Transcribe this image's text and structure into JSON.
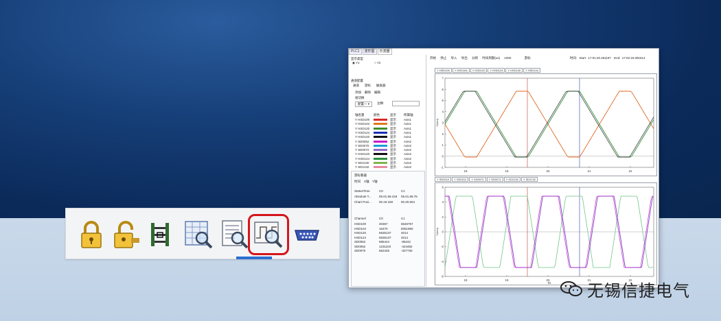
{
  "window": {
    "tabs": [
      "PLC1",
      "波形图",
      "示波器"
    ],
    "display_type_label": "显示类型",
    "radio_y1": "Y1",
    "radio_y2": "Y2",
    "channel_config_label": "通道配置",
    "sub_tabs": [
      "通道",
      "游标",
      "触发器"
    ],
    "actions": [
      "添加",
      "删除",
      "编辑"
    ],
    "group_label": "组切换",
    "group_select": "配置一",
    "note_label": "注释:",
    "table_headers": [
      "轴名量",
      "颜色",
      "显示",
      "所属轴"
    ],
    "channels": [
      {
        "name": "Y HSD100",
        "color": "#d62828",
        "show": "显示",
        "axis": "Axis1"
      },
      {
        "name": "Y HSD104",
        "color": "#e07a1f",
        "show": "显示",
        "axis": "Axis1"
      },
      {
        "name": "Y HSD120",
        "color": "#3c8f2f",
        "show": "显示",
        "axis": "Axis1"
      },
      {
        "name": "Y HSD124",
        "color": "#1b2fb3",
        "show": "显示",
        "axis": "Axis1"
      },
      {
        "name": "Y HSD140",
        "color": "#111111",
        "show": "显示",
        "axis": "Axis1"
      },
      {
        "name": "Y SD0052",
        "color": "#c61bc9",
        "show": "显示",
        "axis": "Axis2"
      },
      {
        "name": "Y SD0070",
        "color": "#1e9bd6",
        "show": "显示",
        "axis": "Axis2"
      },
      {
        "name": "Y SD0072",
        "color": "#8d6ac9",
        "show": "显示",
        "axis": "Axis2"
      },
      {
        "name": "Y HSD140",
        "color": "#111111",
        "show": "显示",
        "axis": "Axis2"
      },
      {
        "name": "Y HSD144",
        "color": "#2a8f3a",
        "show": "显示",
        "axis": "Axis2"
      },
      {
        "name": "Y SD2130",
        "color": "#7fb54a",
        "show": "显示",
        "axis": "Axis2"
      },
      {
        "name": "Y SD2132",
        "color": "#e98aa0",
        "show": "显示",
        "axis": "Axis2"
      }
    ],
    "cursor_panel_title": "游标看器",
    "cursor_tabs": [
      "时间",
      "X轴",
      "Y轴"
    ],
    "status_rows": [
      {
        "k": "StatusTime",
        "c0": "C0",
        "c1": "C1"
      },
      {
        "k": "Absolute T...",
        "c0": "05.01.59.419",
        "c1": "05.01.59.76"
      },
      {
        "k": "Chart Posi...",
        "c0": "00.19.158",
        "c1": "00.20.504"
      }
    ],
    "channel_values_header": {
      "k": "Channel",
      "c0": "C0",
      "c1": "C1"
    },
    "channel_values": [
      {
        "k": "HSD100",
        "c0": "40367",
        "c1": "6546757"
      },
      {
        "k": "HSD104",
        "c0": "16470",
        "c1": "6051960"
      },
      {
        "k": "HSD120",
        "c0": "6535137",
        "c1": "4014"
      },
      {
        "k": "HSD124",
        "c0": "6535137",
        "c1": "4014"
      },
      {
        "k": "SD0052",
        "c0": "685444",
        "c1": "-95242"
      },
      {
        "k": "SD0052",
        "c0": "1231103",
        "c1": "-424482"
      },
      {
        "k": "SD0070",
        "c0": "652425",
        "c1": "-327730"
      }
    ],
    "toolbar_items": [
      "开始",
      "停止",
      "导入",
      "导出",
      "分辨",
      "时间周期(us)",
      "1000",
      "游标"
    ],
    "time_label": "时间:",
    "start_label": "Start:",
    "start_value": "17:01:20.261197",
    "end_label": "End:",
    "end_value": "17:02:15.091614",
    "legend_top": [
      "Y HSD100",
      "Y HSD104",
      "Y HSD120",
      "Y HSD124",
      "Y HSD140",
      "Y HSD144"
    ],
    "legend_bottom": [
      "Y SD0010",
      "Y SD0012",
      "Y SD0070",
      "Y SD0072",
      "Y SD2130",
      "Y SD2132"
    ],
    "top_ylabel": "Y(mm)",
    "bottom_ylabel": "Y(mm)",
    "bottom_xlabel": "t/s",
    "top_yticks": [
      "7",
      "6",
      "5",
      "4",
      "3",
      "2",
      "1",
      "0",
      "-1"
    ],
    "bottom_yticks": [
      "6",
      "4",
      "2",
      "0",
      "-2",
      "-4",
      "-6"
    ],
    "xticks": [
      "18",
      "19",
      "20",
      "21",
      "22"
    ]
  },
  "toolbar": {
    "icons": [
      "lock-icon",
      "unlock-icon",
      "ladder-icon",
      "table-zoom-icon",
      "doc-zoom-icon",
      "oscilloscope-zoom-icon",
      "serial-port-icon"
    ]
  },
  "watermark": {
    "text": "无锡信捷电气"
  },
  "colors": {
    "highlight": "#d4151b",
    "bg_dark": "#0b2e63"
  }
}
